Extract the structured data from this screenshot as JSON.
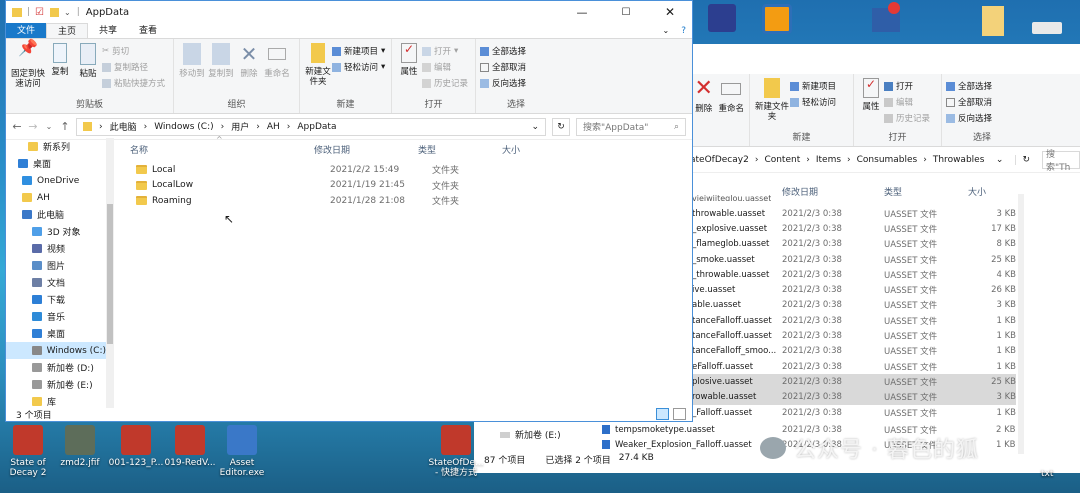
{
  "left_window": {
    "title": "AppData",
    "tabs": [
      "文件",
      "主页",
      "共享",
      "查看"
    ],
    "ribbon": {
      "clipboard": {
        "pin": "固定到快速访问",
        "copy": "复制",
        "paste": "粘贴",
        "cut": "剪切",
        "copy_path": "复制路径",
        "paste_shortcut": "粘贴快捷方式",
        "label": "剪贴板"
      },
      "organize": {
        "move_to": "移动到",
        "copy_to": "复制到",
        "delete": "删除",
        "rename": "重命名",
        "label": "组织"
      },
      "new": {
        "new_folder": "新建文件夹",
        "new_item": "新建项目",
        "easy_access": "轻松访问",
        "label": "新建"
      },
      "open": {
        "properties": "属性",
        "open": "打开",
        "edit": "编辑",
        "history": "历史记录",
        "label": "打开"
      },
      "select": {
        "select_all": "全部选择",
        "select_none": "全部取消",
        "invert": "反向选择",
        "label": "选择"
      }
    },
    "breadcrumb": [
      "此电脑",
      "Windows (C:)",
      "用户",
      "AH",
      "AppData"
    ],
    "search_placeholder": "搜索\"AppData\"",
    "nav": [
      "新系列",
      "桌面",
      "OneDrive",
      "AH",
      "此电脑",
      "3D 对象",
      "视频",
      "图片",
      "文档",
      "下载",
      "音乐",
      "桌面",
      "Windows (C:)",
      "新加卷 (D:)",
      "新加卷 (E:)",
      "库"
    ],
    "columns": {
      "name": "名称",
      "date": "修改日期",
      "type": "类型",
      "size": "大小"
    },
    "files": [
      {
        "name": "Local",
        "date": "2021/2/2 15:49",
        "type": "文件夹"
      },
      {
        "name": "LocalLow",
        "date": "2021/1/19 21:45",
        "type": "文件夹"
      },
      {
        "name": "Roaming",
        "date": "2021/1/28 21:08",
        "type": "文件夹"
      }
    ],
    "status": "3 个项目"
  },
  "right_window": {
    "ribbon": {
      "new_item": "新建项目",
      "easy_access": "轻松访问",
      "new_folder": "新建文件夹",
      "new_label": "新建",
      "delete": "删除",
      "rename": "重命名",
      "properties": "属性",
      "open": "打开",
      "edit": "编辑",
      "history": "历史记录",
      "open_label": "打开",
      "select_all": "全部选择",
      "select_none": "全部取消",
      "invert": "反向选择",
      "select_label": "选择"
    },
    "breadcrumb": [
      "ateOfDecay2",
      "Content",
      "Items",
      "Consumables",
      "Throwables"
    ],
    "search_placeholder": "搜索\"Th",
    "columns": {
      "date": "修改日期",
      "type": "类型",
      "size": "大小"
    },
    "files": [
      {
        "name": "throwable.uasset",
        "date": "2021/2/3 0:38",
        "type": "UASSET 文件",
        "size": "3 KB",
        "hl": false
      },
      {
        "name": "_explosive.uasset",
        "date": "2021/2/3 0:38",
        "type": "UASSET 文件",
        "size": "17 KB",
        "hl": false
      },
      {
        "name": "_flameglob.uasset",
        "date": "2021/2/3 0:38",
        "type": "UASSET 文件",
        "size": "8 KB",
        "hl": false
      },
      {
        "name": "_smoke.uasset",
        "date": "2021/2/3 0:38",
        "type": "UASSET 文件",
        "size": "25 KB",
        "hl": false
      },
      {
        "name": "_throwable.uasset",
        "date": "2021/2/3 0:38",
        "type": "UASSET 文件",
        "size": "4 KB",
        "hl": false
      },
      {
        "name": "ive.uasset",
        "date": "2021/2/3 0:38",
        "type": "UASSET 文件",
        "size": "26 KB",
        "hl": false
      },
      {
        "name": "able.uasset",
        "date": "2021/2/3 0:38",
        "type": "UASSET 文件",
        "size": "3 KB",
        "hl": false
      },
      {
        "name": "tanceFalloff.uasset",
        "date": "2021/2/3 0:38",
        "type": "UASSET 文件",
        "size": "1 KB",
        "hl": false
      },
      {
        "name": "tanceFalloff.uasset",
        "date": "2021/2/3 0:38",
        "type": "UASSET 文件",
        "size": "1 KB",
        "hl": false
      },
      {
        "name": "tanceFalloff_smoo...",
        "date": "2021/2/3 0:38",
        "type": "UASSET 文件",
        "size": "1 KB",
        "hl": false
      },
      {
        "name": "eFalloff.uasset",
        "date": "2021/2/3 0:38",
        "type": "UASSET 文件",
        "size": "1 KB",
        "hl": false
      },
      {
        "name": "plosive.uasset",
        "date": "2021/2/3 0:38",
        "type": "UASSET 文件",
        "size": "25 KB",
        "hl": true
      },
      {
        "name": "rowable.uasset",
        "date": "2021/2/3 0:38",
        "type": "UASSET 文件",
        "size": "3 KB",
        "hl": true
      },
      {
        "name": "_Falloff.uasset",
        "date": "2021/2/3 0:38",
        "type": "UASSET 文件",
        "size": "1 KB",
        "hl": false
      },
      {
        "name": "tempsmoketype.uasset",
        "date": "2021/2/3 0:38",
        "type": "UASSET 文件",
        "size": "2 KB",
        "hl": false
      },
      {
        "name": "Weaker_Explosion_Falloff.uasset",
        "date": "2021/2/3 0:38",
        "type": "UASSET 文件",
        "size": "1 KB",
        "hl": false
      }
    ],
    "partial_top_row": "vieiwiiteglou.uasset",
    "drive_tree_item": "新加卷 (E:)",
    "status": {
      "count": "87 个项目",
      "selected": "已选择 2 个项目",
      "size": "27.4 KB"
    }
  },
  "desktop": {
    "icons": [
      {
        "label": "State of Decay 2",
        "color": "#c0392b"
      },
      {
        "label": "zmd2.jfif",
        "color": "#5d6d5a"
      },
      {
        "label": "001-123_P...",
        "color": "#c0392b"
      },
      {
        "label": "019-RedV...",
        "color": "#c0392b"
      },
      {
        "label": "Asset Editor.exe",
        "color": "#3a78c8"
      },
      {
        "label": "StateOfDe... - 快捷方式",
        "color": "#c0392b"
      }
    ],
    "trailing_label": "txt"
  },
  "watermark": "公众号 · 暮色的狐"
}
